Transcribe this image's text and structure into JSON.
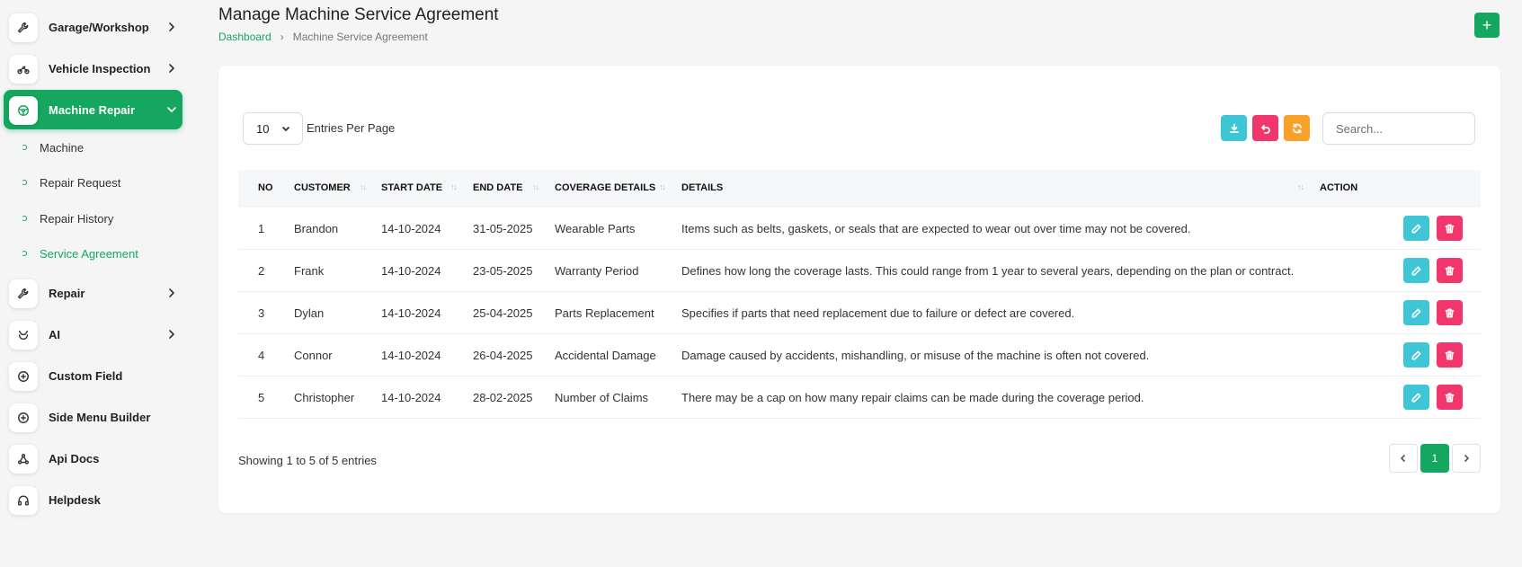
{
  "sidebar": {
    "items": [
      {
        "label": "Garage/Workshop",
        "icon": "wrench-icon"
      },
      {
        "label": "Vehicle Inspection",
        "icon": "motorcycle-icon"
      },
      {
        "label": "Machine Repair",
        "icon": "steering-icon"
      },
      {
        "label": "Repair",
        "icon": "wrench-icon"
      },
      {
        "label": "AI",
        "icon": "ai-icon"
      },
      {
        "label": "Custom Field",
        "icon": "plus-circle-icon"
      },
      {
        "label": "Side Menu Builder",
        "icon": "plus-circle-icon"
      },
      {
        "label": "Api Docs",
        "icon": "api-icon"
      },
      {
        "label": "Helpdesk",
        "icon": "headphones-icon"
      }
    ],
    "sub_items": [
      {
        "label": "Machine"
      },
      {
        "label": "Repair Request"
      },
      {
        "label": "Repair History"
      },
      {
        "label": "Service Agreement"
      }
    ]
  },
  "header": {
    "title": "Manage Machine Service Agreement",
    "breadcrumb_home": "Dashboard",
    "breadcrumb_current": "Machine Service Agreement",
    "add_label": "+"
  },
  "toolbar": {
    "per_page_value": "10",
    "per_page_label": "Entries Per Page",
    "search_placeholder": "Search..."
  },
  "table": {
    "columns": [
      "NO",
      "CUSTOMER",
      "START DATE",
      "END DATE",
      "COVERAGE DETAILS",
      "DETAILS",
      "ACTION"
    ],
    "rows": [
      {
        "no": "1",
        "customer": "Brandon",
        "start": "14-10-2024",
        "end": "31-05-2025",
        "coverage": "Wearable Parts",
        "details": "Items such as belts, gaskets, or seals that are expected to wear out over time may not be covered."
      },
      {
        "no": "2",
        "customer": "Frank",
        "start": "14-10-2024",
        "end": "23-05-2025",
        "coverage": "Warranty Period",
        "details": "Defines how long the coverage lasts. This could range from 1 year to several years, depending on the plan or contract."
      },
      {
        "no": "3",
        "customer": "Dylan",
        "start": "14-10-2024",
        "end": "25-04-2025",
        "coverage": "Parts Replacement",
        "details": "Specifies if parts that need replacement due to failure or defect are covered."
      },
      {
        "no": "4",
        "customer": "Connor",
        "start": "14-10-2024",
        "end": "26-04-2025",
        "coverage": "Accidental Damage",
        "details": "Damage caused by accidents, mishandling, or misuse of the machine is often not covered."
      },
      {
        "no": "5",
        "customer": "Christopher",
        "start": "14-10-2024",
        "end": "28-02-2025",
        "coverage": "Number of Claims",
        "details": "There may be a cap on how many repair claims can be made during the coverage period."
      }
    ]
  },
  "footer": {
    "showing": "Showing 1 to 5 of 5 entries",
    "current_page": "1"
  },
  "colors": {
    "accent": "#15a660",
    "export": "#3ec5d6",
    "reset": "#f0366b",
    "refresh": "#f7a12b"
  }
}
